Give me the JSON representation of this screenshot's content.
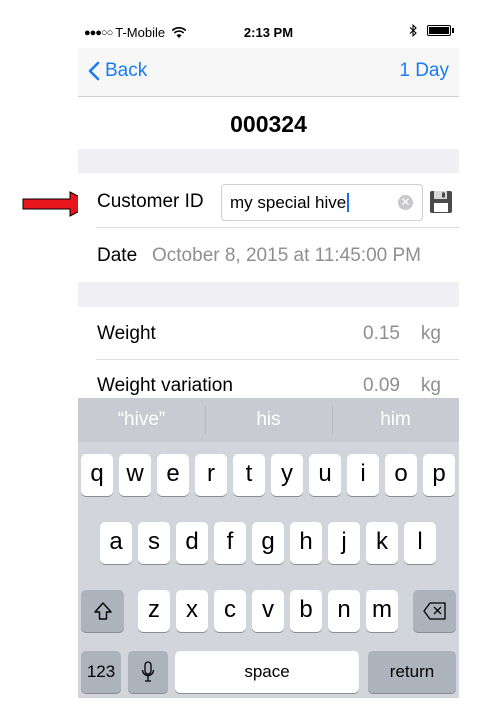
{
  "status_bar": {
    "carrier": "T-Mobile",
    "signal_dots": "●●●○○",
    "time": "2:13 PM"
  },
  "nav": {
    "back_label": "Back",
    "right_label": "1 Day"
  },
  "record_title": "000324",
  "form": {
    "customer_id_label": "Customer ID",
    "customer_id_value": "my special hive",
    "date_label": "Date",
    "date_value": "October 8, 2015 at 11:45:00 PM",
    "weight_label": "Weight",
    "weight_value": "0.15",
    "weight_unit": "kg",
    "weight_variation_label": "Weight variation",
    "weight_variation_value": "0.09",
    "weight_variation_unit": "kg"
  },
  "keyboard": {
    "suggestions": [
      "“hive”",
      "his",
      "him"
    ],
    "row1": [
      "q",
      "w",
      "e",
      "r",
      "t",
      "y",
      "u",
      "i",
      "o",
      "p"
    ],
    "row2": [
      "a",
      "s",
      "d",
      "f",
      "g",
      "h",
      "j",
      "k",
      "l"
    ],
    "row3": [
      "z",
      "x",
      "c",
      "v",
      "b",
      "n",
      "m"
    ],
    "numbers_label": "123",
    "space_label": "space",
    "return_label": "return"
  },
  "colors": {
    "accent": "#1a7cf4",
    "annotation_arrow": "#e8161a"
  }
}
